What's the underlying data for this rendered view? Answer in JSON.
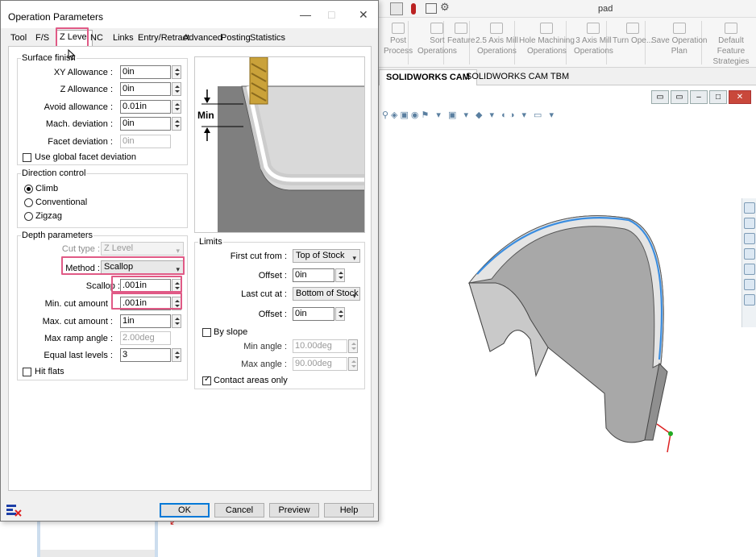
{
  "dialog": {
    "title": "Operation Parameters",
    "tabs": [
      "Tool",
      "F/S",
      "Z Level",
      "NC",
      "Links",
      "Entry/Retract",
      "Advanced",
      "Posting",
      "Statistics"
    ],
    "active_tab": "Z Level",
    "surface_finish": {
      "label": "Surface finish",
      "xy_allowance": {
        "label": "XY Allowance :",
        "value": "0in"
      },
      "z_allowance": {
        "label": "Z Allowance :",
        "value": "0in"
      },
      "avoid_allowance": {
        "label": "Avoid allowance :",
        "value": "0.01in"
      },
      "mach_deviation": {
        "label": "Mach. deviation :",
        "value": "0in"
      },
      "facet_deviation": {
        "label": "Facet deviation :",
        "value": "0in"
      },
      "use_global_facet": "Use global facet deviation"
    },
    "direction_control": {
      "label": "Direction control",
      "options": [
        "Climb",
        "Conventional",
        "Zigzag"
      ],
      "selected": "Climb"
    },
    "depth_parameters": {
      "label": "Depth parameters",
      "cut_type": {
        "label": "Cut type :",
        "value": "Z Level"
      },
      "method": {
        "label": "Method :",
        "value": "Scallop"
      },
      "scallop": {
        "label": "Scallop :",
        "value": ".001in"
      },
      "min_cut": {
        "label": "Min. cut amount :",
        "value": ".001in"
      },
      "max_cut": {
        "label": "Max. cut amount :",
        "value": "1in"
      },
      "max_ramp": {
        "label": "Max ramp angle :",
        "value": "2.00deg"
      },
      "equal_last": {
        "label": "Equal last levels :",
        "value": "3"
      },
      "hit_flats": "Hit flats"
    },
    "illustration": {
      "min_label": "Min"
    },
    "limits": {
      "label": "Limits",
      "first_cut": {
        "label": "First cut from :",
        "value": "Top of Stock"
      },
      "offset1": {
        "label": "Offset :",
        "value": "0in"
      },
      "last_cut": {
        "label": "Last cut at :",
        "value": "Bottom of Stock"
      },
      "offset2": {
        "label": "Offset :",
        "value": "0in"
      },
      "by_slope": "By slope",
      "min_angle": {
        "label": "Min angle :",
        "value": "10.00deg"
      },
      "max_angle": {
        "label": "Max angle :",
        "value": "90.00deg"
      },
      "contact_areas": "Contact areas only"
    },
    "buttons": {
      "ok": "OK",
      "cancel": "Cancel",
      "preview": "Preview",
      "help": "Help"
    }
  },
  "app": {
    "title": "pad",
    "ribbon": [
      {
        "l1": "Post",
        "l2": "Process"
      },
      {
        "l1": "Sort",
        "l2": "Operations"
      },
      {
        "l1": "Feature",
        "l2": ""
      },
      {
        "l1": "2.5 Axis Mill",
        "l2": "Operations"
      },
      {
        "l1": "Hole Machining",
        "l2": "Operations"
      },
      {
        "l1": "3 Axis Mill",
        "l2": "Operations"
      },
      {
        "l1": "Turn Ope...",
        "l2": ""
      },
      {
        "l1": "Save Operation",
        "l2": "Plan"
      },
      {
        "l1": "Default Feature",
        "l2": "Strategies"
      }
    ],
    "cam_tabs": [
      "SOLIDWORKS CAM",
      "SOLIDWORKS CAM TBM"
    ]
  },
  "colors": {
    "highlight": "#e05a86",
    "edge_blue": "#3a8de0",
    "part_gray": "#a9a9a9"
  }
}
